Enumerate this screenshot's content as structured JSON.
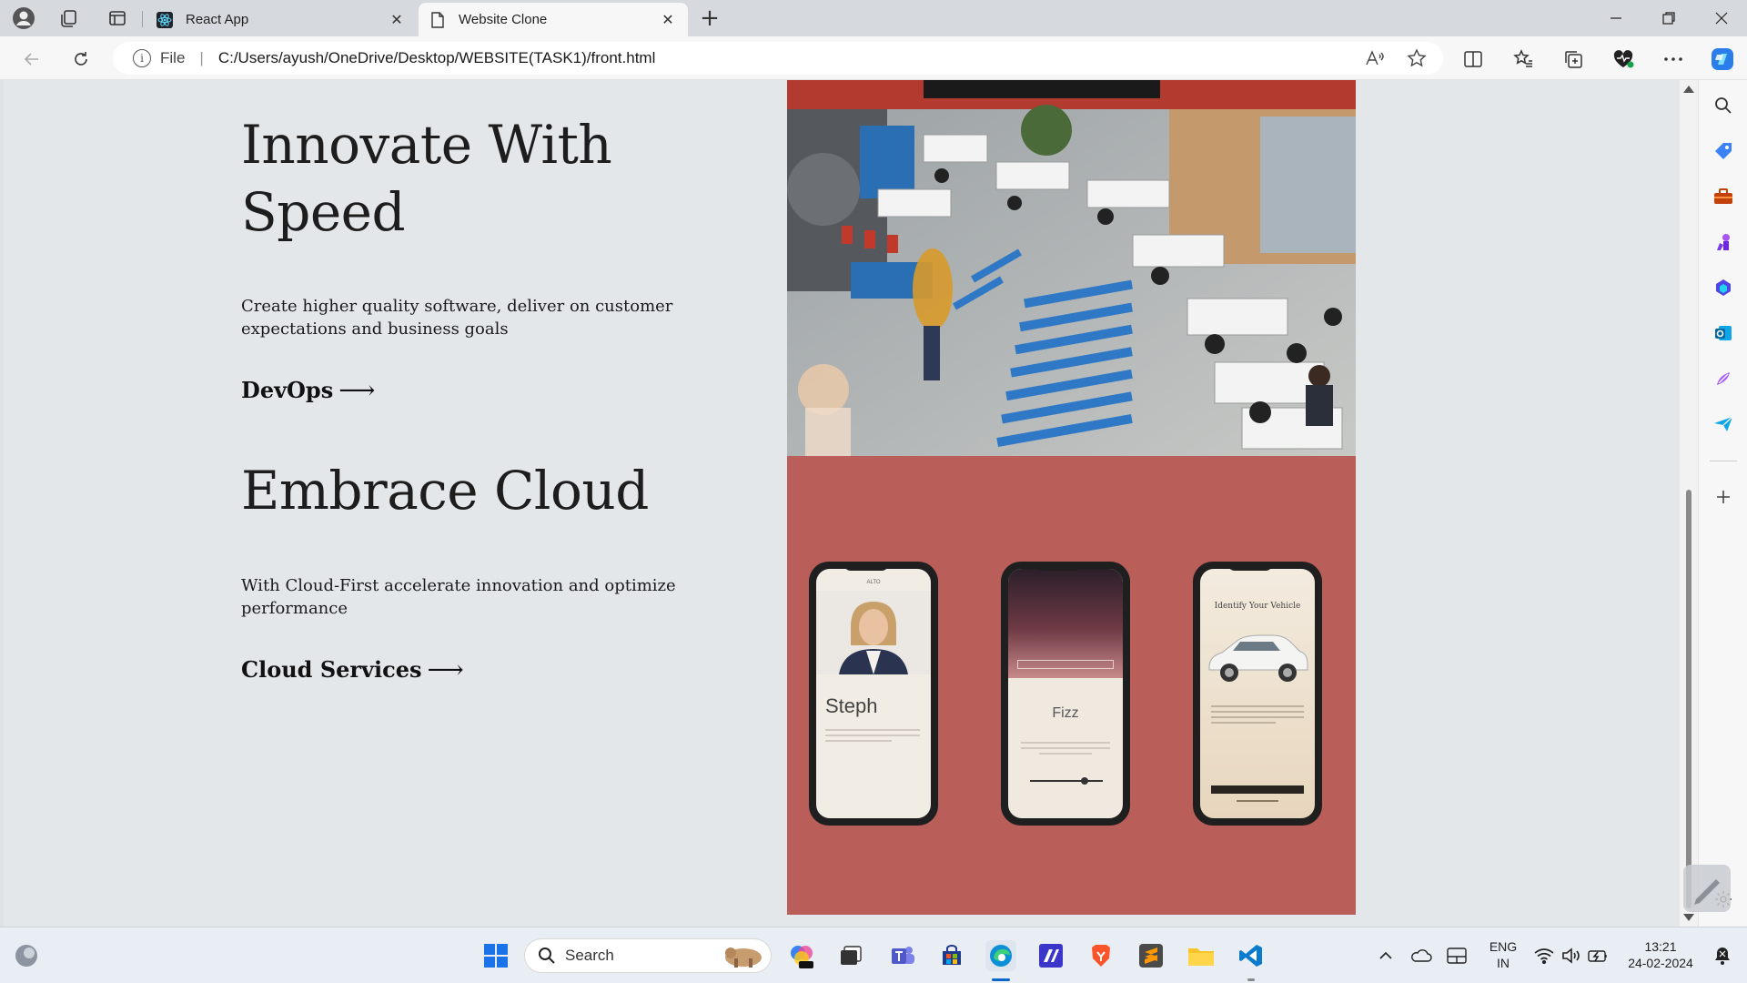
{
  "browser": {
    "tabs": [
      {
        "label": "React App",
        "active": false
      },
      {
        "label": "Website Clone",
        "active": true
      }
    ],
    "address": {
      "scheme_label": "File",
      "url": "C:/Users/ayush/OneDrive/Desktop/WEBSITE(TASK1)/front.html"
    }
  },
  "page": {
    "sections": [
      {
        "heading_line1": "Innovate With",
        "heading_line2": "Speed",
        "description": "Create higher quality software, deliver on customer expectations and business goals",
        "cta_label": "DevOps",
        "cta_arrow": "⟶"
      },
      {
        "heading_line1": "Embrace Cloud",
        "description": "With Cloud-First accelerate innovation and optimize performance",
        "cta_label": "Cloud Services",
        "cta_arrow": "⟶"
      }
    ],
    "phones": [
      {
        "top_label": "ALTO",
        "name": "Steph"
      },
      {
        "top_label": "",
        "name": "Fizz"
      },
      {
        "top_label": "",
        "title": "Identify Your Vehicle"
      }
    ],
    "panel_color": "#b95e59"
  },
  "taskbar": {
    "search_label": "Search",
    "language_line1": "ENG",
    "language_line2": "IN",
    "time": "13:21",
    "date": "24-02-2024"
  }
}
